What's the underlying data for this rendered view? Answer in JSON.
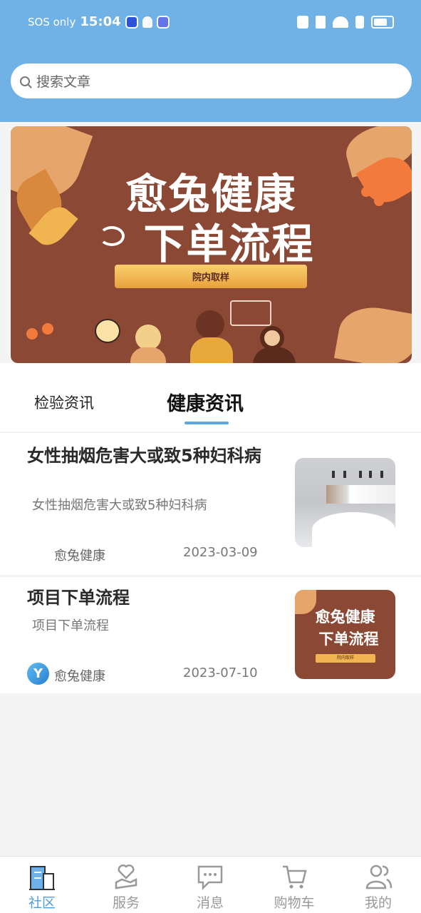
{
  "status_bar": {
    "carrier": "SOS only",
    "time": "15:04"
  },
  "search": {
    "placeholder": "搜索文章"
  },
  "banner": {
    "title_line1": "愈兔健康",
    "title_line2": "下单流程",
    "button_label": "院内取样"
  },
  "tabs": {
    "inspect": "检验资讯",
    "health": "健康资讯",
    "active": "health"
  },
  "articles": [
    {
      "title": "女性抽烟危害大或致5种妇科病",
      "summary": "女性抽烟危害大或致5种妇科病",
      "author": "愈兔健康",
      "date": "2023-03-09",
      "thumbnail": "smoking-image"
    },
    {
      "title": "项目下单流程",
      "summary": "项目下单流程",
      "author": "愈兔健康",
      "date": "2023-07-10",
      "thumbnail": "order-process-banner",
      "thumb_title1": "愈兔健康",
      "thumb_title2": "下单流程",
      "thumb_button": "院内取样"
    }
  ],
  "bottom_nav": [
    {
      "label": "社区",
      "icon": "building-icon",
      "active": true
    },
    {
      "label": "服务",
      "icon": "heart-hand-icon",
      "active": false
    },
    {
      "label": "消息",
      "icon": "chat-icon",
      "active": false
    },
    {
      "label": "购物车",
      "icon": "cart-icon",
      "active": false
    },
    {
      "label": "我的",
      "icon": "user-icon",
      "active": false
    }
  ],
  "colors": {
    "header": "#71b2e6",
    "accent": "#4d9de0",
    "banner_bg": "#8b4935"
  }
}
